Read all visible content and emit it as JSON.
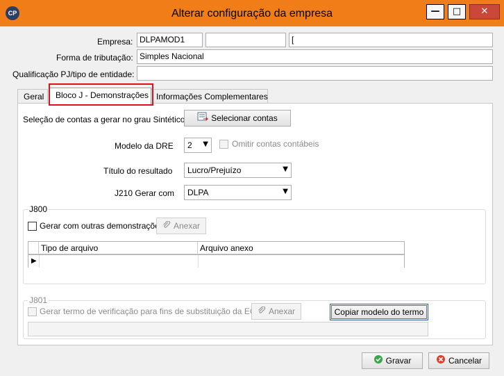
{
  "window": {
    "title": "Alterar configuração da empresa",
    "app_icon": "CP",
    "minimize": "—",
    "maximize": "□",
    "close": "✕"
  },
  "header": {
    "empresa_label": "Empresa:",
    "empresa_value": "DLPAMOD1",
    "empresa_field2": "",
    "empresa_field3": "[",
    "forma_label": "Forma de tributação:",
    "forma_value": "Simples Nacional",
    "qualificacao_label": "Qualificação PJ/tipo de entidade:",
    "qualificacao_value": ""
  },
  "tabs": [
    {
      "label": "Geral"
    },
    {
      "label": "Bloco J - Demonstrações"
    },
    {
      "label": "Informações Complementares"
    }
  ],
  "bloco_j": {
    "selecao_label": "Seleção de contas a gerar no grau Sintético",
    "selecionar_button": "Selecionar contas",
    "modelo_dre_label": "Modelo da DRE",
    "modelo_dre_value": "2",
    "omitir_label": "Omitir contas contábeis",
    "titulo_label": "Título do resultado",
    "titulo_value": "Lucro/Prejuízo",
    "j210_label": "J210 Gerar com",
    "j210_value": "DLPA"
  },
  "j800": {
    "title": "J800",
    "gerar_label": "Gerar com outras demonstrações",
    "anexar_button": "Anexar",
    "columns": [
      "Tipo de arquivo",
      "Arquivo anexo"
    ]
  },
  "j801": {
    "title": "J801",
    "gerar_label": "Gerar termo de verificação para fins de substituição da ECD",
    "anexar_button": "Anexar",
    "copiar_button": "Copiar modelo do termo",
    "path_value": ""
  },
  "footer": {
    "gravar_button": "Gravar",
    "cancelar_button": "Cancelar"
  },
  "colors": {
    "titlebar": "#f07d18",
    "highlight": "#e0101a"
  }
}
